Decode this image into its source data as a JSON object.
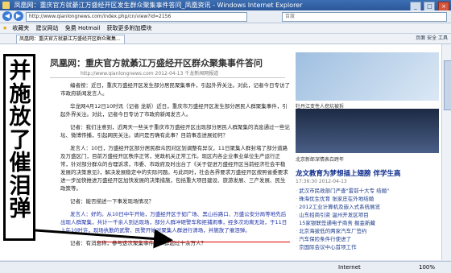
{
  "window": {
    "title": "凤凰网：重庆官方就綦江万盛经开区发生群众聚集事件答问_凤凰资讯 - Windows Internet Explorer",
    "address": "http://www.qianlongnews.com/index.php/cn/view?id=2156",
    "search_placeholder": "百度",
    "tab_label": "凤凰网：重庆官方就綦江万盛经开区群众聚集...",
    "tools": "页面  安全  工具"
  },
  "favorites": {
    "label": "收藏夹",
    "items": [
      "建议网站",
      "免费 Hotmail",
      "获取更多附加模块"
    ]
  },
  "article": {
    "title": "凤凰网：重庆官方就綦江万盛经开区群众聚集事件答问",
    "meta": "http://www.qianlongnews.com 2012-04-13 千龙新闻网报道",
    "paragraphs": [
      "编者按：近日，重庆万盛经开区发生部分居民聚集事件，引起外界关注。对此，记者今日专访了市政府新闻发言人。",
      "华龙网4月12日10时讯（记者 龙新）近日，重庆市万盛经开区发生部分居民人群聚集事件，引起外界关注。对此，记者今日专访了市政府新闻发言人。",
      "记者：我们注意到，近两天一些关于重庆市万盛经开区出现部分居民人群聚集的消息通过一些论坛、微博传播，引起网民关注。请问是否确有此事？目前事态进展如何？",
      "发言人：10日，万盛经开区部分居民群众因对区划调整有异议，11日聚集人群封堵了部分道路及万盛区门，目前万盛经开区秩序正常，党政机关正常工作。现区内各企业事业单位生产运行正常，针对部分群众的合理诉求，市委、市政府及时出台了《关于促进万盛经开区当前经济社会平稳发展的决策意见》，解决发展稳定中的实际问题。与此同时，社会各界要求万盛经开区按照省委要求进一步加快推进万盛经开区加快发展的决策措施，包括重大项目建设、旅游发展、三产发展、民生政策等。",
      "记者：能否描述一下事发现场情况？",
      "发言人：好的。从10日中午开始，万盛经开区于如广场、黑山谷路口、万盛公安分局等地先后出现人群聚集，共计一千余人到达现场，部分人群冲砸警车和拒捕闹事，经多次劝离无效，于11日上午10时许，现场执勤的武警、民警开始对聚集人群进行清场，并施放了催泪弹。",
      "记者：有消息称，参与这次聚集事件的人群超过十余万人？"
    ],
    "underlined": "并施放了催泪弹"
  },
  "sidebar": {
    "ad_caption": "牡丹江变性人挖坑被拆",
    "photo_caption": "北京新郎深情表白跨年",
    "headline": "龙文教育为梦想插上翅膀 伴学生高",
    "time": "17:36:30  2012-04-13",
    "links": [
      "武汉市民政部门严查\"雷前十大专 结婚\"",
      "珠海优生优育 张家庄在外地结婚",
      "2012工业计算机及嵌入式系统展览",
      "山东招商引资 温州开发区项目",
      "15家银联签通电子商务 掘金新藏",
      "北京海拔低的两家汽车厂签约",
      "汽车保险条件行使进了",
      "京国际会议中心首项工作"
    ]
  },
  "overlay": {
    "label": "并施放了催泪弹"
  },
  "status": {
    "zone": "Internet",
    "zoom": "100%"
  }
}
